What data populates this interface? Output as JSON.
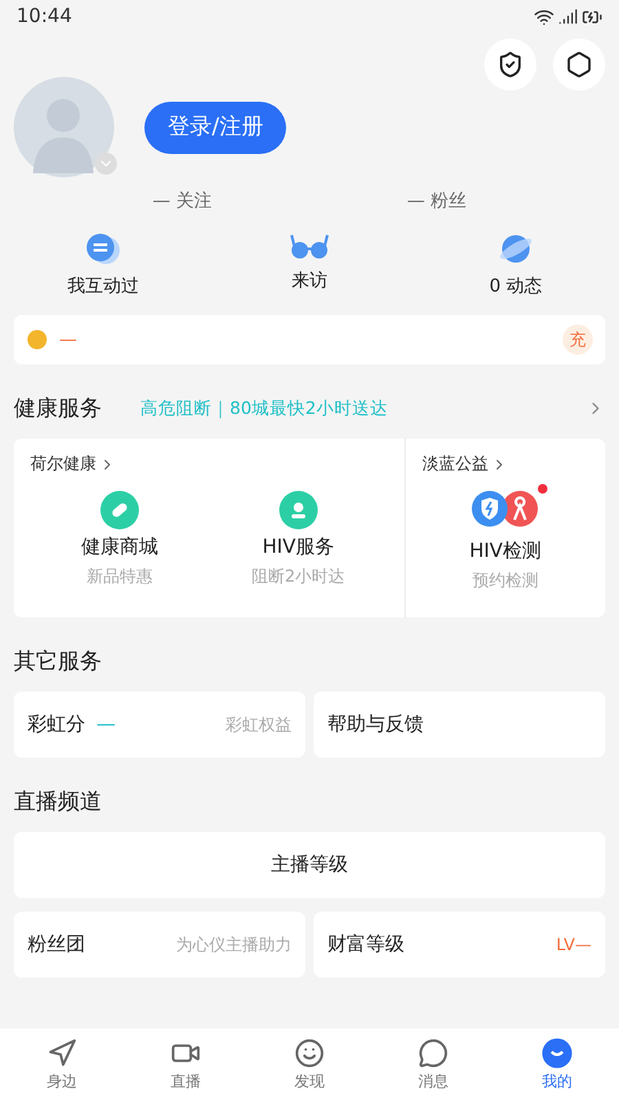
{
  "status_bar": {
    "time": "10:44"
  },
  "profile": {
    "login_button": "登录/注册",
    "stats": [
      {
        "value": "—",
        "label": "关注"
      },
      {
        "value": "—",
        "label": "粉丝"
      }
    ]
  },
  "quick_actions": [
    {
      "kind": "chat",
      "label": "我互动过"
    },
    {
      "kind": "glasses",
      "label": "来访"
    },
    {
      "kind": "planet",
      "label": "0 动态"
    }
  ],
  "balance": {
    "value": "—",
    "recharge": "充"
  },
  "health": {
    "title": "健康服务",
    "promo": "高危阻断｜80城最快2小时送达",
    "groups": [
      {
        "name": "荷尔健康",
        "items": [
          {
            "kind": "pill",
            "title": "健康商城",
            "subtitle": "新品特惠",
            "badge": false
          },
          {
            "kind": "doctor",
            "title": "HIV服务",
            "subtitle": "阻断2小时达",
            "badge": false
          }
        ]
      },
      {
        "name": "淡蓝公益",
        "items": [
          {
            "kind": "test",
            "title": "HIV检测",
            "subtitle": "预约检测",
            "badge": true
          }
        ]
      }
    ]
  },
  "other_services": {
    "title": "其它服务",
    "cards": [
      {
        "label": "彩虹分",
        "value": "—",
        "hint": "彩虹权益"
      },
      {
        "label": "帮助与反馈"
      }
    ]
  },
  "live": {
    "title": "直播频道",
    "wide": "主播等级",
    "cards": [
      {
        "label": "粉丝团",
        "hint": "为心仪主播助力"
      },
      {
        "label": "财富等级",
        "level_text": "LV—"
      }
    ]
  },
  "tabs": [
    {
      "kind": "nearby",
      "label": "身边",
      "selected": false
    },
    {
      "kind": "live",
      "label": "直播",
      "selected": false
    },
    {
      "kind": "discover",
      "label": "发现",
      "selected": false
    },
    {
      "kind": "messages",
      "label": "消息",
      "selected": false
    },
    {
      "kind": "me",
      "label": "我的",
      "selected": true
    }
  ]
}
